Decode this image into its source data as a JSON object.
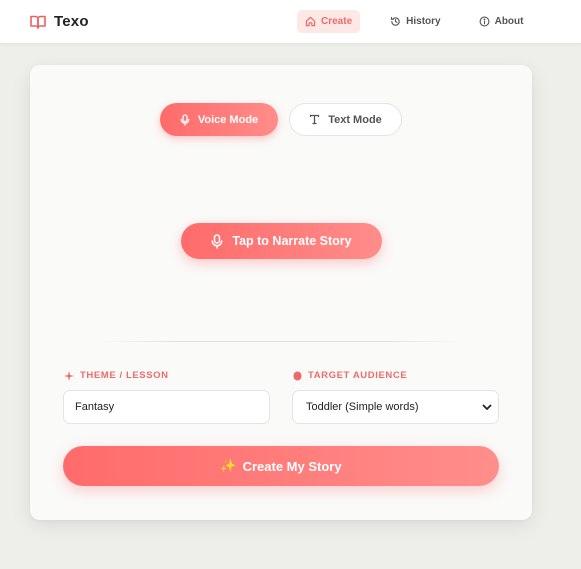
{
  "app": {
    "name": "Texo"
  },
  "nav": [
    {
      "label": "Create",
      "icon": "home-icon",
      "active": true
    },
    {
      "label": "History",
      "icon": "history-icon",
      "active": false
    },
    {
      "label": "About",
      "icon": "info-icon",
      "active": false
    }
  ],
  "modes": {
    "voice_label": "Voice Mode",
    "text_label": "Text Mode",
    "selected": "voice"
  },
  "narrate": {
    "label": "Tap to Narrate Story"
  },
  "theme": {
    "label": "THEME / LESSON",
    "value": "Fantasy"
  },
  "audience": {
    "label": "TARGET AUDIENCE",
    "selected": "Toddler (Simple words)"
  },
  "create": {
    "label": "Create My Story",
    "emoji": "✨"
  },
  "colors": {
    "accent": "#ff6b6b",
    "accent_light": "#ff8d8a",
    "nav_active_bg": "#fde8e6"
  }
}
